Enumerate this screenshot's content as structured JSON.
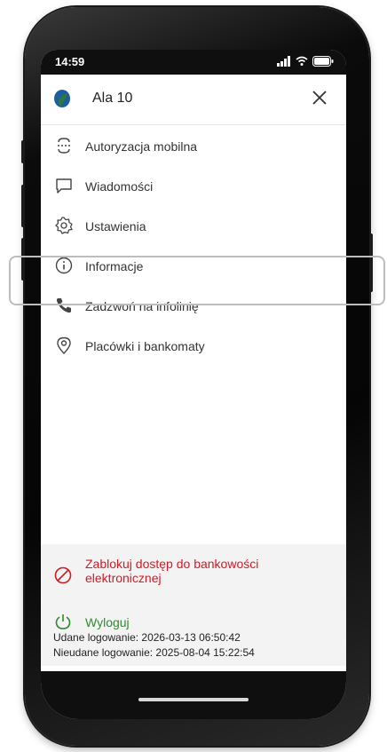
{
  "status_bar": {
    "time": "14:59"
  },
  "header": {
    "user_name": "Ala 10"
  },
  "menu": {
    "items": [
      {
        "label": "Autoryzacja mobilna",
        "icon": "mobile-authorization-icon"
      },
      {
        "label": "Wiadomości",
        "icon": "message-icon"
      },
      {
        "label": "Ustawienia",
        "icon": "gear-icon"
      },
      {
        "label": "Informacje",
        "icon": "info-icon"
      },
      {
        "label": "Zadzwoń na infolinię",
        "icon": "phone-icon"
      },
      {
        "label": "Placówki i bankomaty",
        "icon": "location-pin-icon"
      }
    ]
  },
  "block_access": {
    "label": "Zablokuj dostęp do bankowości elektronicznej",
    "color": "#d11a24"
  },
  "logout": {
    "label": "Wyloguj",
    "color": "#2e8b2e"
  },
  "login_info": {
    "success": "Udane logowanie: 2026-03-13 06:50:42",
    "failed": "Nieudane logowanie: 2025-08-04 15:22:54"
  }
}
